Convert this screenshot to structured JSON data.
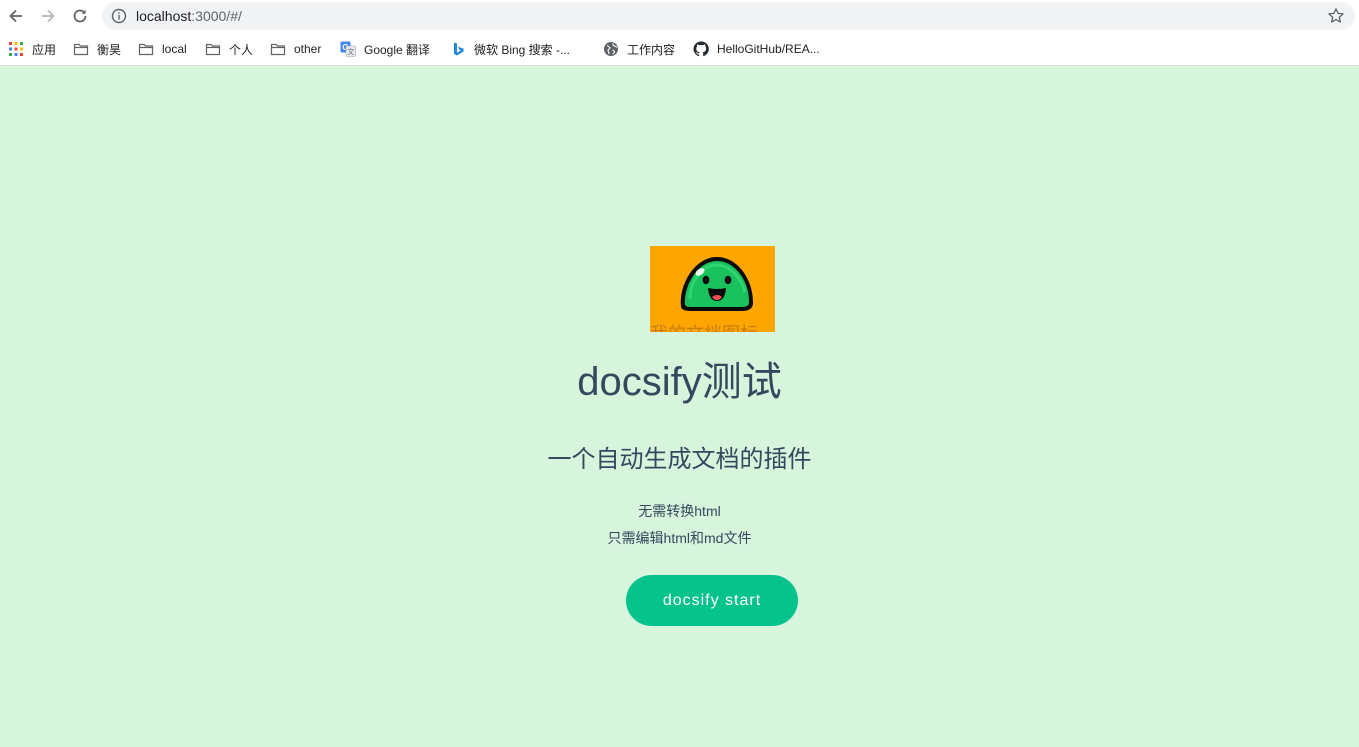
{
  "browser": {
    "url_host": "localhost",
    "url_path": ":3000/#/",
    "icons": {
      "back": "arrow-left-icon",
      "forward": "arrow-right-icon",
      "reload": "reload-icon",
      "info": "info-icon",
      "star": "star-icon"
    }
  },
  "bookmarks": [
    {
      "label": "应用",
      "icon": "apps-grid-icon"
    },
    {
      "label": "衡昊",
      "icon": "folder-icon"
    },
    {
      "label": "local",
      "icon": "folder-icon"
    },
    {
      "label": "个人",
      "icon": "folder-icon"
    },
    {
      "label": "other",
      "icon": "folder-icon"
    },
    {
      "label": "Google 翻译",
      "icon": "google-translate-icon"
    },
    {
      "label": "微软 Bing 搜索 -...",
      "icon": "bing-icon"
    },
    {
      "label": "工作内容",
      "icon": "globe-icon"
    },
    {
      "label": "HelloGitHub/REA...",
      "icon": "github-icon"
    }
  ],
  "cover": {
    "logo_text_cut": "我的文档图标",
    "title": "docsify测试",
    "subtitle": "一个自动生成文档的插件",
    "lines": [
      "无需转换html",
      "只需编辑html和md文件"
    ],
    "button_label": "docsify start",
    "colors": {
      "background": "#d7f4dd",
      "logo_background": "#ffa500",
      "button": "#06c38b",
      "text": "#34495e"
    }
  }
}
